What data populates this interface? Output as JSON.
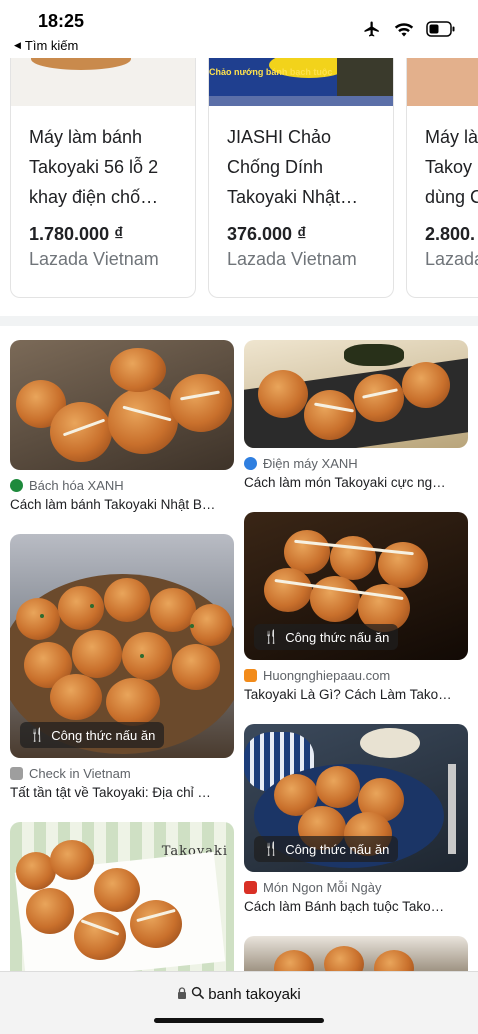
{
  "status": {
    "time": "18:25",
    "back_label": "Tìm kiếm",
    "icons": [
      "airplane-icon",
      "wifi-icon",
      "battery-icon"
    ]
  },
  "shopping": {
    "cards": [
      {
        "title": "Máy làm bánh\nTakoyaki 56 lỗ 2\nkhay điện chố…",
        "price": "1.780.000 ₫",
        "store": "Lazada Vietnam",
        "banner_text": ""
      },
      {
        "title": "JIASHI Chảo\nChống Dính\nTakoyaki Nhật…",
        "price": "376.000 ₫",
        "store": "Lazada Vietnam",
        "banner_text": "Chảo nướng bánh bạch tuộc"
      },
      {
        "title": "Máy là\nTakoy\ndùng C",
        "price": "2.800.",
        "store": "Lazada",
        "banner_text": ""
      }
    ]
  },
  "results": {
    "left": [
      {
        "source": "Bách hóa XANH",
        "title": "Cách làm bánh Takoyaki Nhật B…",
        "badge_color": "#1e8a3c",
        "chip": ""
      },
      {
        "source": "Check in Vietnam",
        "title": "Tất tần tật về Takoyaki: Địa chỉ …",
        "badge_color": "#9e9e9e",
        "chip": "Công thức nấu ăn"
      },
      {
        "source": "",
        "title": "",
        "badge_color": "",
        "chip": "",
        "overlay_text": "Takoyaki"
      }
    ],
    "right": [
      {
        "source": "Điện máy XANH",
        "title": "Cách làm món Takoyaki cực ng…",
        "badge_color": "#2f7fe0",
        "chip": ""
      },
      {
        "source": "Huongnghiepaau.com",
        "title": "Takoyaki Là Gì? Cách Làm Tako…",
        "badge_color": "#f28b1a",
        "chip": "Công thức nấu ăn"
      },
      {
        "source": "Món Ngon Mỗi Ngày",
        "title": "Cách làm Bánh bạch tuộc Tako…",
        "badge_color": "#d93025",
        "chip": "Công thức nấu ăn"
      }
    ]
  },
  "address_bar": {
    "url": "banh takoyaki",
    "icons": [
      "lock-icon",
      "search-icon"
    ]
  }
}
